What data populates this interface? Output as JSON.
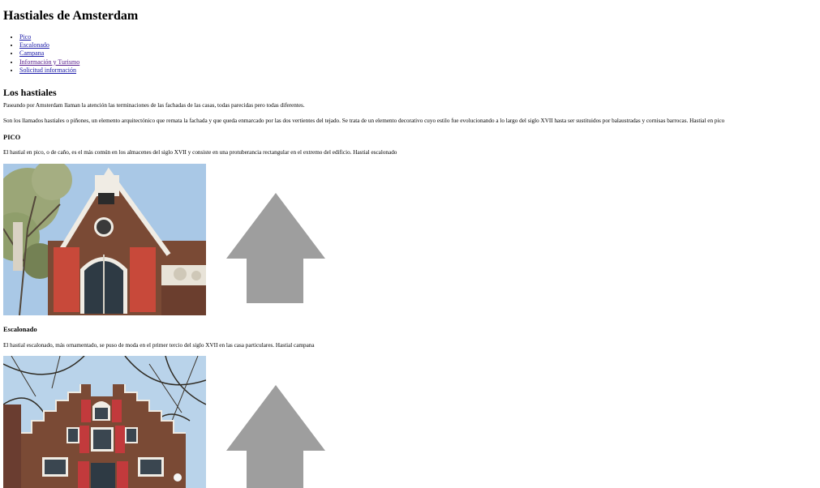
{
  "page": {
    "title": "Hastiales de Amsterdam"
  },
  "nav": {
    "items": [
      {
        "label": "Pico",
        "visited": false
      },
      {
        "label": "Escalonado",
        "visited": false
      },
      {
        "label": "Campana",
        "visited": false
      },
      {
        "label": "Información y Turismo",
        "visited": true
      },
      {
        "label": "Solicitud información",
        "visited": false
      }
    ]
  },
  "intro": {
    "heading": "Los hastiales",
    "paragraph1": "Paseando por Amsterdam llaman la atención las terminaciones de las fachadas de las casas, todas parecidas pero todas diferentes.",
    "paragraph2": "Son los llamados hastiales o piñones, un elemento arquitectónico que remata la fachada y que queda enmarcado por las dos vertientes del tejado. Se trata de un elemento decorativo cuyo estilo fue evolucionando a lo largo del siglo XVII hasta ser sustituidos por balaustradas y cornisas barrocas. Hastial en pico"
  },
  "sections": {
    "pico": {
      "heading": "PICO",
      "text": "El hastial en pico, o de caño, es el más común en los almacenes del siglo XVII y consiste en una protuberancia rectangular en el extremo del edificio. Hastial escalonado",
      "arrow_icon": "up-arrow-icon"
    },
    "escalonado": {
      "heading": "Escalonado",
      "text": "El hastial escalonado, más ornamentado, se puso de moda en el primer tercio del siglo XVII en las casa particulares. Hastial campana",
      "arrow_icon": "up-arrow-icon"
    }
  },
  "colors": {
    "link": "#1a1aa8",
    "visited_link": "#551a8b",
    "arrow": "#9e9e9e",
    "sky": "#a9c8e6",
    "brick": "#7a4a35",
    "shutter_red": "#c8493a"
  }
}
